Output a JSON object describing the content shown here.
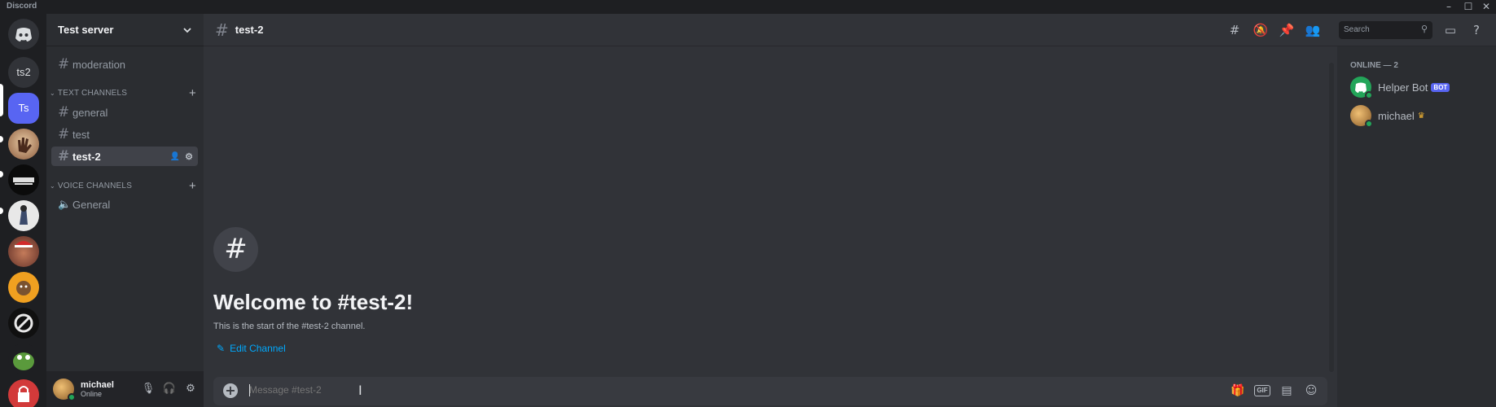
{
  "window": {
    "app_title": "Discord",
    "controls": [
      "–",
      "☐",
      "✕"
    ]
  },
  "servers": {
    "home_icon": "discord-logo-icon",
    "items": [
      {
        "label": "ts2"
      },
      {
        "label": "Ts",
        "active": true
      }
    ]
  },
  "sidebar": {
    "server_name": "Test server",
    "top_channels": [
      {
        "label": "moderation"
      }
    ],
    "text_category": "TEXT CHANNELS",
    "text_channels": [
      {
        "label": "general"
      },
      {
        "label": "test"
      },
      {
        "label": "test-2",
        "selected": true
      }
    ],
    "voice_category": "VOICE CHANNELS",
    "voice_channels": [
      {
        "label": "General"
      }
    ]
  },
  "user_panel": {
    "name": "michael",
    "status": "Online"
  },
  "header": {
    "channel": "test-2",
    "search_placeholder": "Search",
    "icons": [
      "threads-icon",
      "mute-bell-icon",
      "pin-icon",
      "members-icon",
      "inbox-icon",
      "help-icon"
    ]
  },
  "welcome": {
    "title": "Welcome to #test-2!",
    "subtitle": "This is the start of the #test-2 channel.",
    "edit_label": "Edit Channel"
  },
  "composer": {
    "placeholder": "Message #test-2",
    "gif_label": "GIF"
  },
  "members": {
    "group_label": "ONLINE — 2",
    "items": [
      {
        "name": "Helper Bot",
        "tag": "BOT"
      },
      {
        "name": "michael",
        "owner": true
      }
    ]
  },
  "colors": {
    "accent": "#5865f2",
    "online": "#23a559",
    "link": "#00a8fc"
  }
}
